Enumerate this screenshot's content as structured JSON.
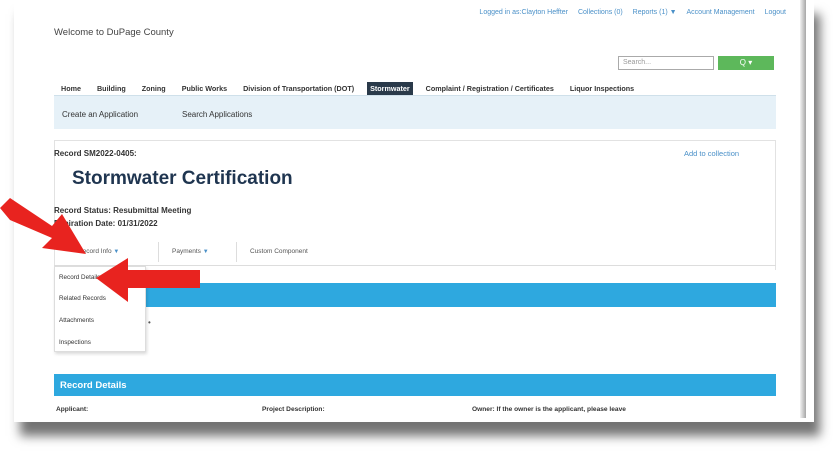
{
  "header": {
    "welcome": "Welcome to DuPage County",
    "top_links": [
      "Logged in as:Clayton Heffter",
      "Collections (0)",
      "Reports (1) ▼",
      "Account Management",
      "Logout"
    ]
  },
  "search": {
    "placeholder": "Search...",
    "button_label": "Q ▾"
  },
  "main_nav": {
    "items": [
      "Home",
      "Building",
      "Zoning",
      "Public Works",
      "Division of Transportation (DOT)",
      "Stormwater",
      "Complaint / Registration / Certificates",
      "Liquor Inspections"
    ],
    "active_index": 5
  },
  "sub_nav": {
    "create": "Create an Application",
    "search": "Search Applications"
  },
  "record": {
    "number": "Record SM2022-0405:",
    "add_to_collection": "Add to collection",
    "title": "Stormwater Certification",
    "status": "Record Status: Resubmittal Meeting",
    "expiration": "Expiration Date: 01/31/2022"
  },
  "tabs": {
    "record_info": "Record Info",
    "payments": "Payments",
    "custom_component": "Custom Component"
  },
  "dropdown": {
    "items": [
      "Record Details",
      "Related Records",
      "Attachments",
      "Inspections"
    ]
  },
  "details": {
    "heading": "Record Details",
    "applicant_label": "Applicant:",
    "project_label": "Project Description:",
    "owner_label": "Owner: If the owner is the applicant, please leave"
  },
  "colors": {
    "accent_blue": "#2ea8df",
    "annotation_red": "#e8231f",
    "title_navy": "#1f3550"
  }
}
